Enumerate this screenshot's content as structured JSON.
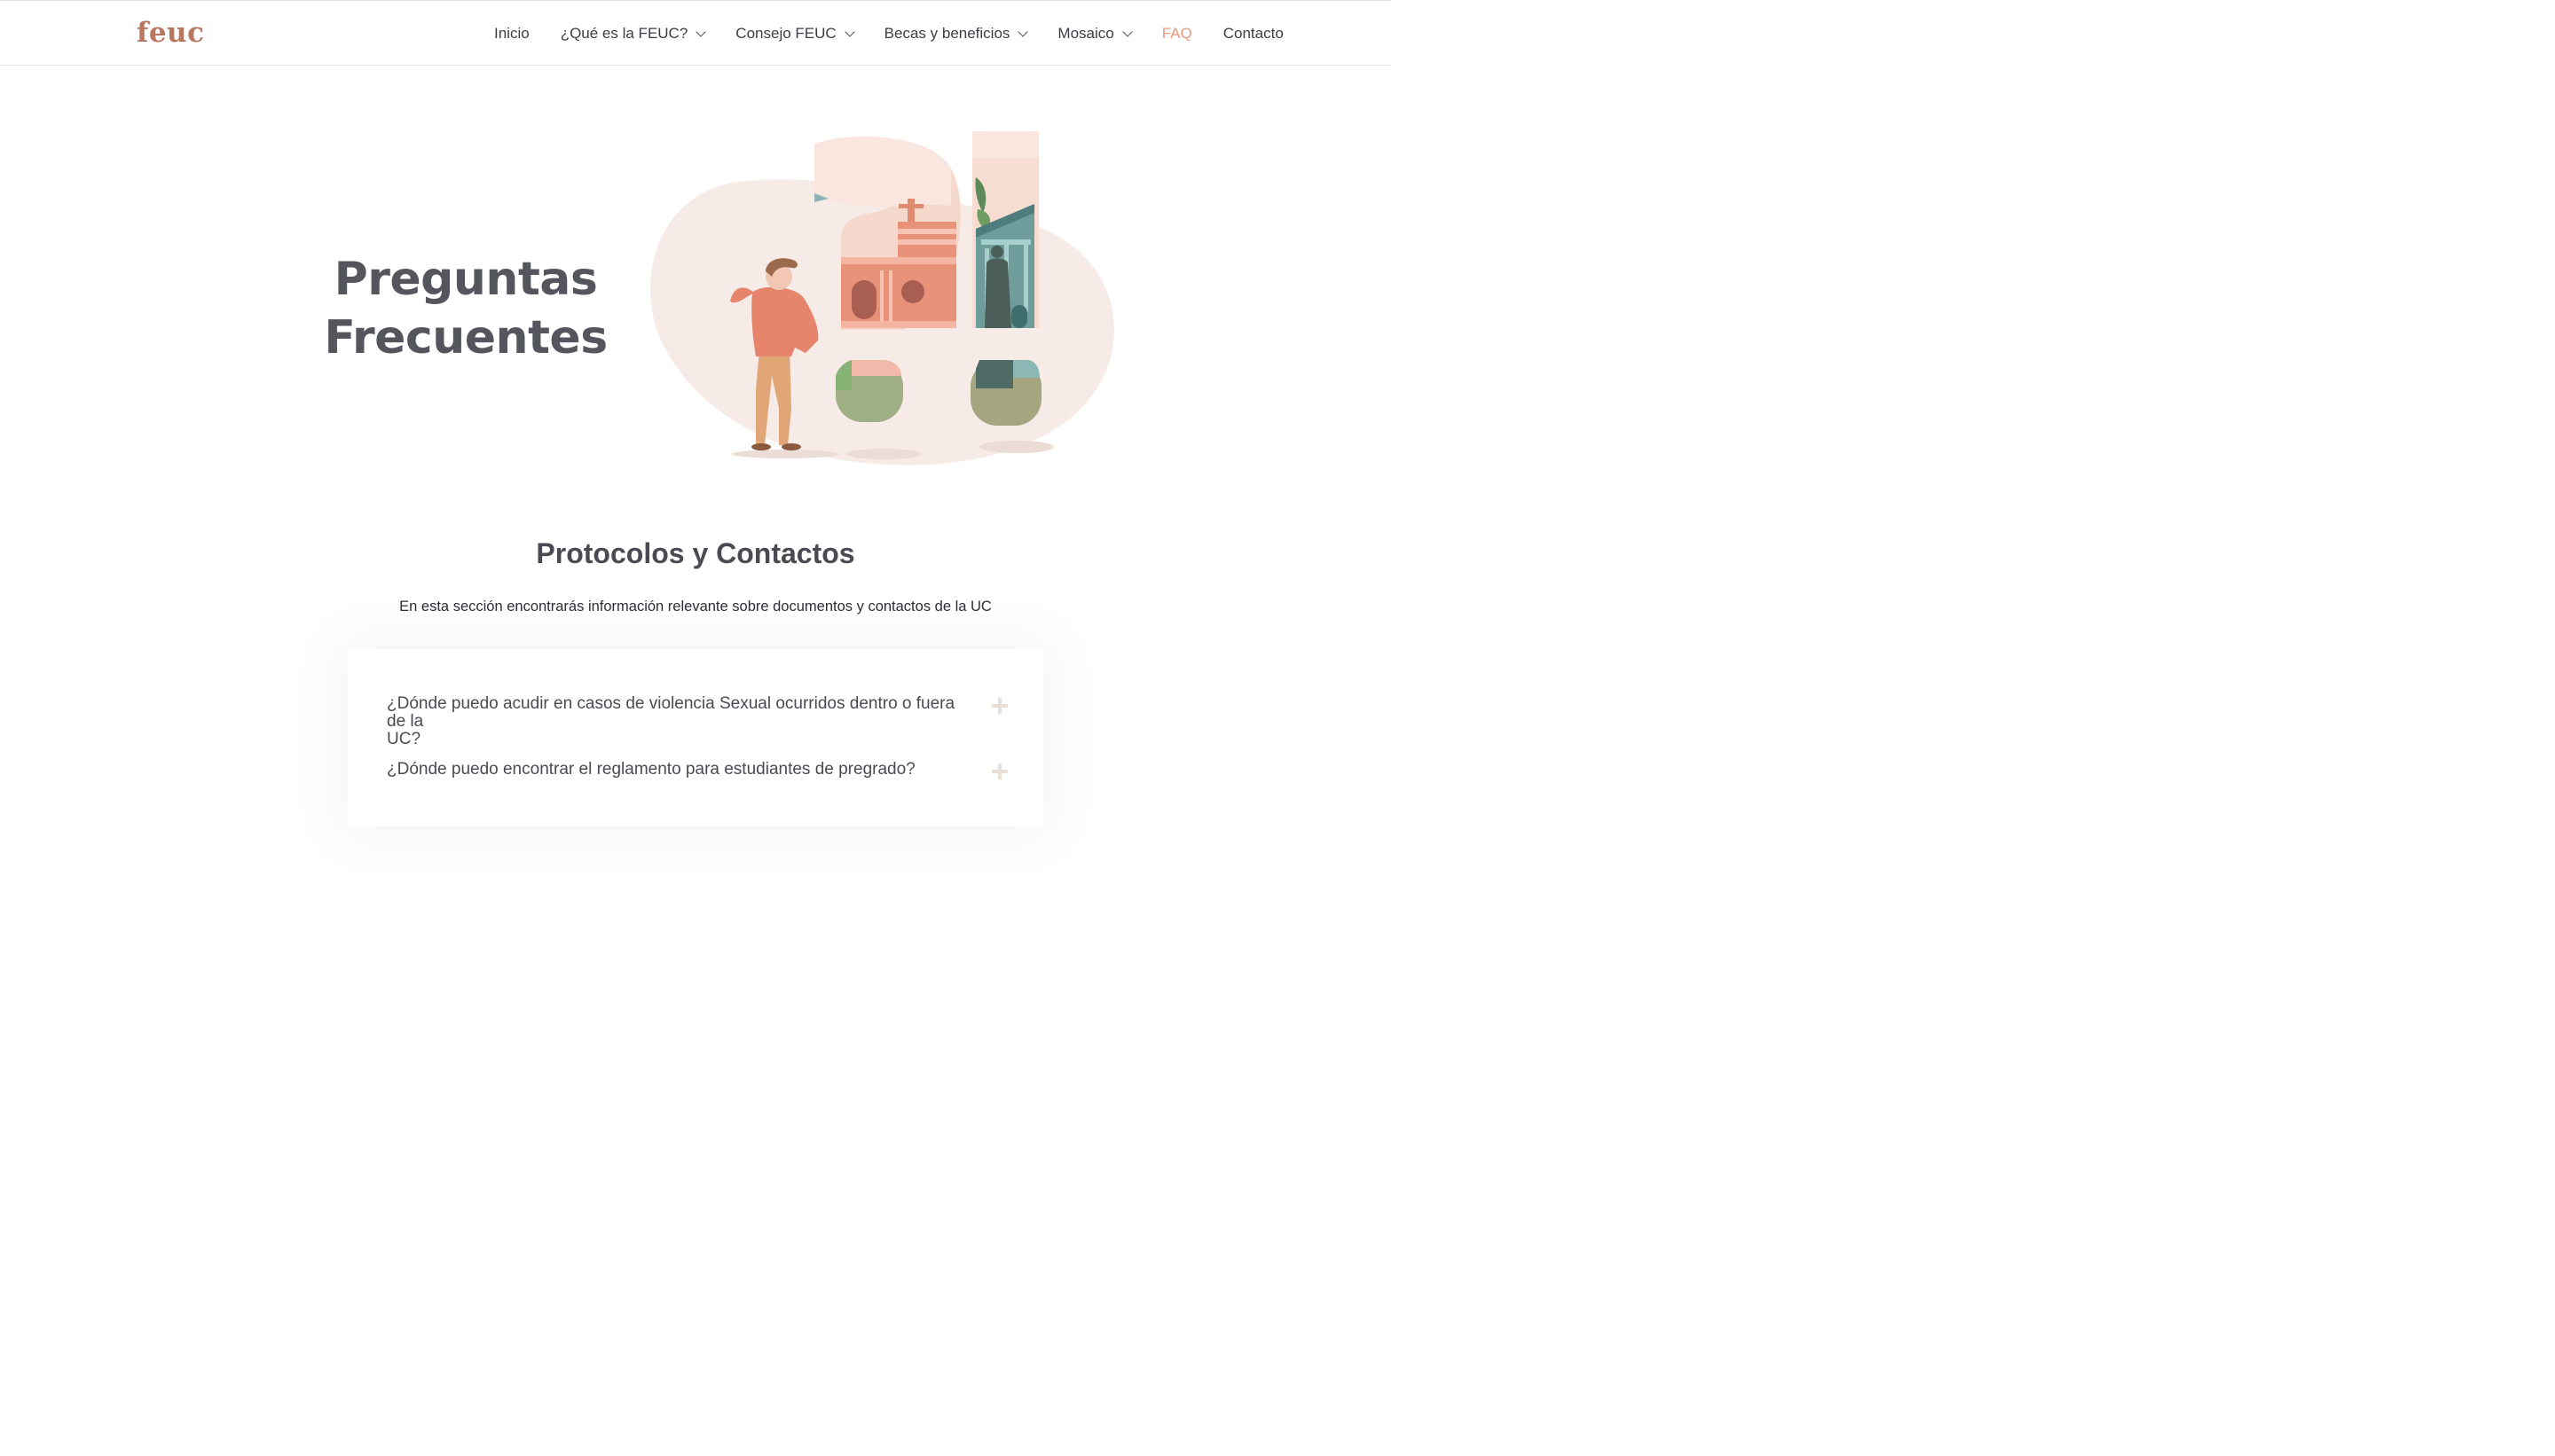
{
  "brand": {
    "logo_text": "feuc",
    "color": "#b9775f"
  },
  "nav": {
    "items": [
      {
        "label": "Inicio",
        "dropdown": false,
        "active": false
      },
      {
        "label": "¿Qué es la FEUC?",
        "dropdown": true,
        "active": false
      },
      {
        "label": "Consejo FEUC",
        "dropdown": true,
        "active": false
      },
      {
        "label": "Becas y beneficios",
        "dropdown": true,
        "active": false
      },
      {
        "label": "Mosaico",
        "dropdown": true,
        "active": false
      },
      {
        "label": "FAQ",
        "dropdown": false,
        "active": true
      },
      {
        "label": "Contacto",
        "dropdown": false,
        "active": false
      }
    ],
    "active_color": "#e59a7c"
  },
  "hero": {
    "title_line1": "Preguntas",
    "title_line2": "Frecuentes"
  },
  "section": {
    "title": "Protocolos y Contactos",
    "description": "En esta sección encontrarás información relevante sobre documentos y contactos de la UC"
  },
  "faq": {
    "items": [
      {
        "question_line1": "¿Dónde puedo acudir en casos de violencia Sexual ocurridos dentro o fuera de la",
        "question_line2": "UC?"
      },
      {
        "question_line1": "¿Dónde puedo encontrar el reglamento para estudiantes de pregrado?",
        "question_line2": ""
      }
    ]
  }
}
